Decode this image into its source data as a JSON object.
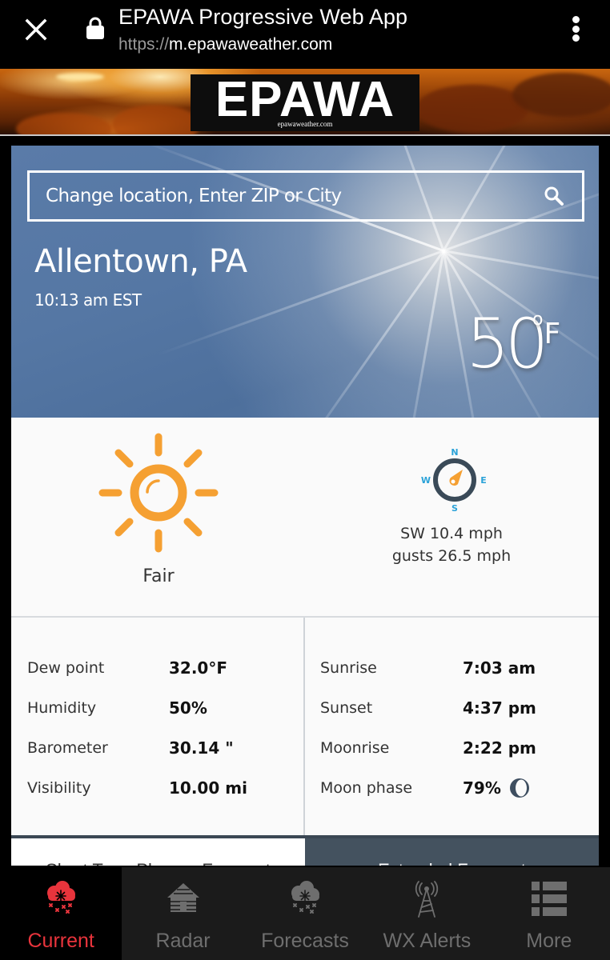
{
  "browser": {
    "title": "EPAWA Progressive Web App",
    "url_scheme": "https://",
    "url_host": "m.epawaweather.com",
    "close_icon": "close-icon",
    "lock_icon": "lock-icon",
    "menu_icon": "more-vert-icon"
  },
  "banner": {
    "logo_text": "EPAWA",
    "logo_subtext": "epawaweather.com"
  },
  "hero": {
    "search_placeholder": "Change location, Enter ZIP or City",
    "search_icon": "search-icon",
    "city": "Allentown, PA",
    "local_time": "10:13 am EST",
    "temperature": "50",
    "temperature_unit_degree": "o",
    "temperature_unit": "F"
  },
  "conditions": {
    "icon": "sun-icon",
    "label": "Fair",
    "compass_icon": "compass-icon",
    "compass_letters": {
      "n": "N",
      "e": "E",
      "s": "S",
      "w": "W"
    },
    "wind": "SW 10.4 mph",
    "gusts": "gusts 26.5 mph",
    "colors": {
      "sun": "#f5a032",
      "compass_ring": "#3a4a58",
      "compass_needle": "#f5a032",
      "compass_letters": "#2aa2d8"
    }
  },
  "details": {
    "left": [
      {
        "label": "Dew point",
        "value": "32.0°F"
      },
      {
        "label": "Humidity",
        "value": "50%"
      },
      {
        "label": "Barometer",
        "value": "30.14 \""
      },
      {
        "label": "Visibility",
        "value": "10.00 mi"
      }
    ],
    "right": [
      {
        "label": "Sunrise",
        "value": "7:03 am"
      },
      {
        "label": "Sunset",
        "value": "4:37 pm"
      },
      {
        "label": "Moonrise",
        "value": "2:22 pm"
      },
      {
        "label": "Moon phase",
        "value": "79%",
        "icon": "moon-phase-icon"
      }
    ]
  },
  "forecast_tabs": [
    {
      "label": "Short Term Planner Forecast",
      "active": true
    },
    {
      "label": "Extended Forecast",
      "active": false
    }
  ],
  "bottom_nav": {
    "items": [
      {
        "label": "Current",
        "icon": "snow-cloud-icon",
        "active": true
      },
      {
        "label": "Radar",
        "icon": "cabin-icon",
        "active": false
      },
      {
        "label": "Forecasts",
        "icon": "snow-cloud-icon",
        "active": false
      },
      {
        "label": "WX Alerts",
        "icon": "radio-tower-icon",
        "active": false
      },
      {
        "label": "More",
        "icon": "list-icon",
        "active": false
      }
    ],
    "colors": {
      "active": "#e8343c",
      "inactive": "#6e6e6e"
    }
  }
}
